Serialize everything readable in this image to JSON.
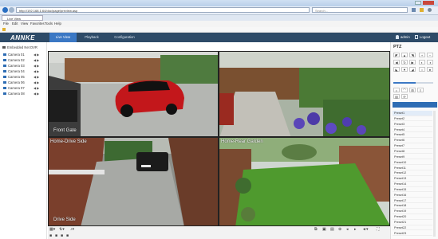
{
  "browser": {
    "address": "http://192.168.1.64/doc/page/preview.asp",
    "search_placeholder": "Search...",
    "tab_title": "Live View",
    "menu": [
      "File",
      "Edit",
      "View",
      "Favorites",
      "Tools",
      "Help"
    ]
  },
  "app": {
    "logo": "ANNKE",
    "tabs": [
      "Live View",
      "Playback",
      "Configuration"
    ],
    "active_tab": "Live View",
    "user": "admin",
    "logout": "Logout",
    "accent": "#3b78c4",
    "header_bg": "#2e4b68"
  },
  "sidebar": {
    "device": "Embedded Net DVR",
    "cameras": [
      "Camera 01",
      "Camera 02",
      "Camera 03",
      "Camera 04",
      "Camera 05",
      "Camera 06",
      "Camera 07",
      "Camera 08"
    ]
  },
  "tiles": [
    {
      "label": "Front Gate"
    },
    {
      "label": ""
    },
    {
      "label": "Drive Side",
      "top_label": "Home-Drive Side"
    },
    {
      "label": "",
      "top_label": "Home-Rear Garden"
    }
  ],
  "ptz": {
    "title": "PTZ",
    "presets": [
      "Preset1",
      "Preset2",
      "Preset3",
      "Preset4",
      "Preset5",
      "Preset6",
      "Preset7",
      "Preset8",
      "Preset9",
      "Preset10",
      "Preset11",
      "Preset12",
      "Preset13",
      "Preset14",
      "Preset15",
      "Preset16",
      "Preset17",
      "Preset18",
      "Preset19",
      "Preset20",
      "Preset21",
      "Preset22",
      "Preset23"
    ],
    "slider_level": 0.55
  }
}
